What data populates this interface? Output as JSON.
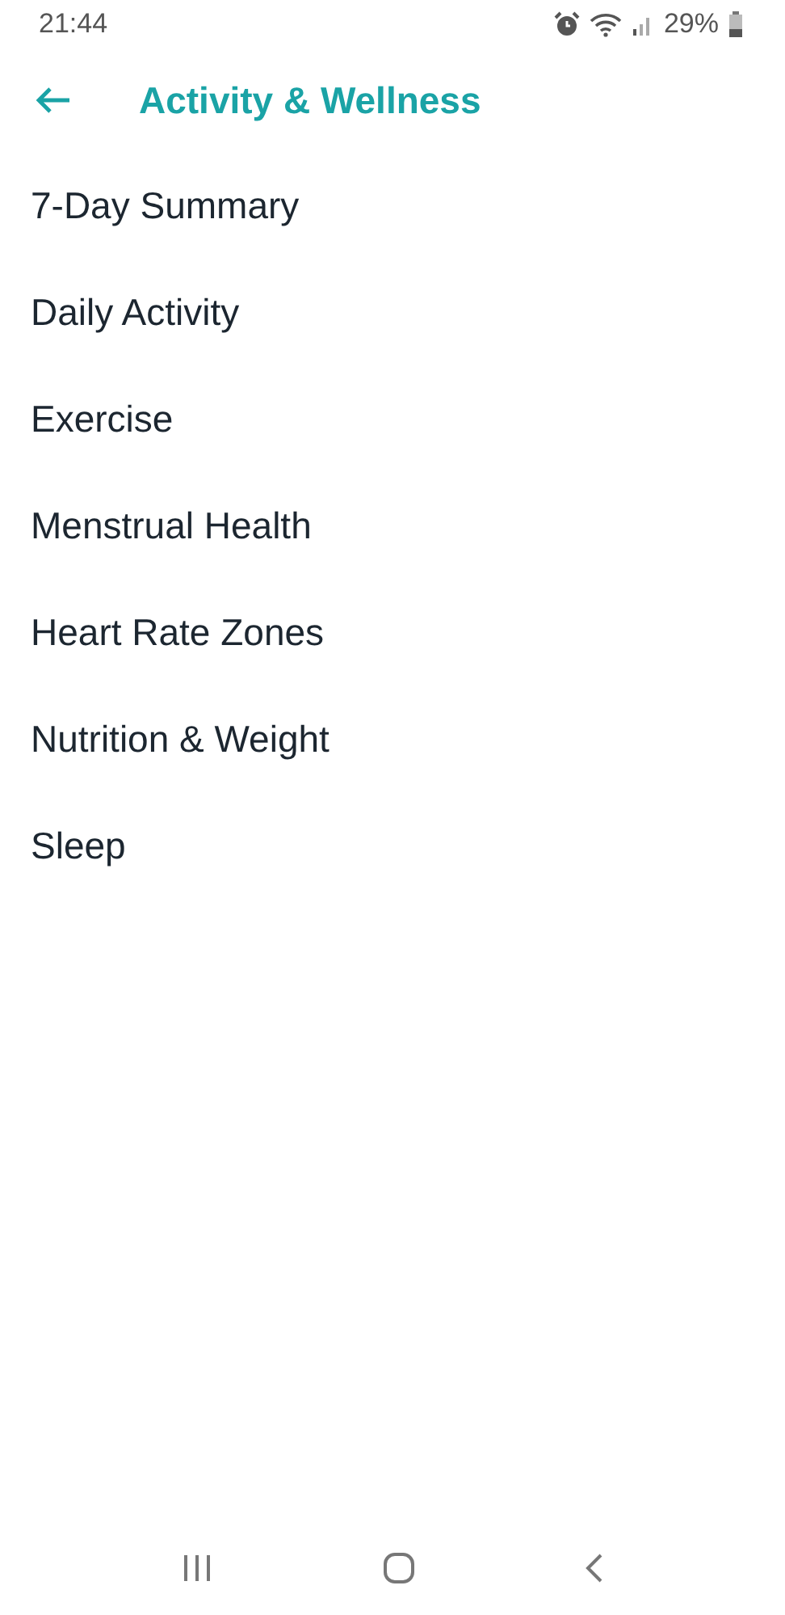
{
  "status_bar": {
    "time": "21:44",
    "battery": "29%"
  },
  "header": {
    "title": "Activity & Wellness"
  },
  "items": [
    {
      "label": "7-Day Summary"
    },
    {
      "label": "Daily Activity"
    },
    {
      "label": "Exercise"
    },
    {
      "label": "Menstrual Health"
    },
    {
      "label": "Heart Rate Zones"
    },
    {
      "label": "Nutrition & Weight"
    },
    {
      "label": "Sleep"
    }
  ]
}
